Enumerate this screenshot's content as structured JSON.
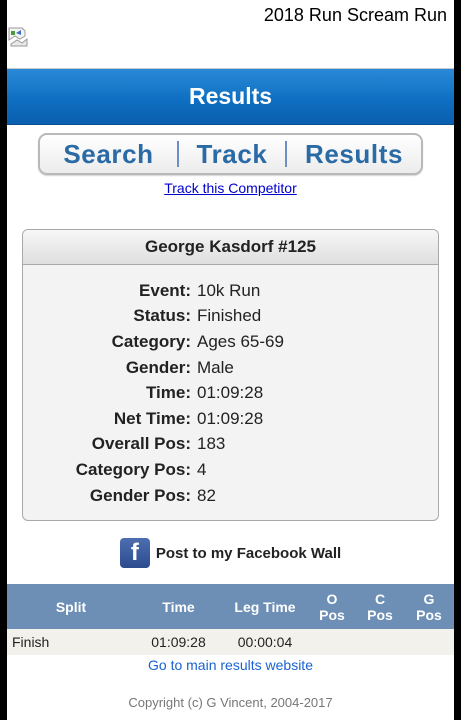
{
  "event_title": "2018 Run Scream Run",
  "banner_title": "Results",
  "nav": {
    "search": "Search",
    "track": "Track",
    "results": "Results"
  },
  "track_link": "Track this Competitor",
  "competitor": {
    "header": "George Kasdorf #125",
    "details": [
      {
        "label": "Event:",
        "value": "10k Run"
      },
      {
        "label": "Status:",
        "value": "Finished"
      },
      {
        "label": "Category:",
        "value": "Ages 65-69"
      },
      {
        "label": "Gender:",
        "value": "Male"
      },
      {
        "label": "Time:",
        "value": "01:09:28"
      },
      {
        "label": "Net Time:",
        "value": "01:09:28"
      },
      {
        "label": "Overall Pos:",
        "value": "183"
      },
      {
        "label": "Category Pos:",
        "value": "4"
      },
      {
        "label": "Gender Pos:",
        "value": "82"
      }
    ]
  },
  "facebook": {
    "icon_letter": "f",
    "label": "Post to my Facebook Wall"
  },
  "splits_table": {
    "headers": {
      "split": "Split",
      "time": "Time",
      "leg_time": "Leg Time",
      "o_pos_1": "O",
      "o_pos_2": "Pos",
      "c_pos_1": "C",
      "c_pos_2": "Pos",
      "g_pos_1": "G",
      "g_pos_2": "Pos"
    },
    "rows": [
      {
        "split": "Finish",
        "time": "01:09:28",
        "leg_time": "00:00:04",
        "o_pos": "",
        "c_pos": "",
        "g_pos": ""
      }
    ]
  },
  "main_results_link": "Go to main results website",
  "copyright": "Copyright (c) G Vincent, 2004-2017",
  "colors": {
    "banner": "#1a7fd0",
    "nav_text": "#2a6aa5",
    "table_header": "#6d8fb6",
    "link": "#0000cc"
  }
}
